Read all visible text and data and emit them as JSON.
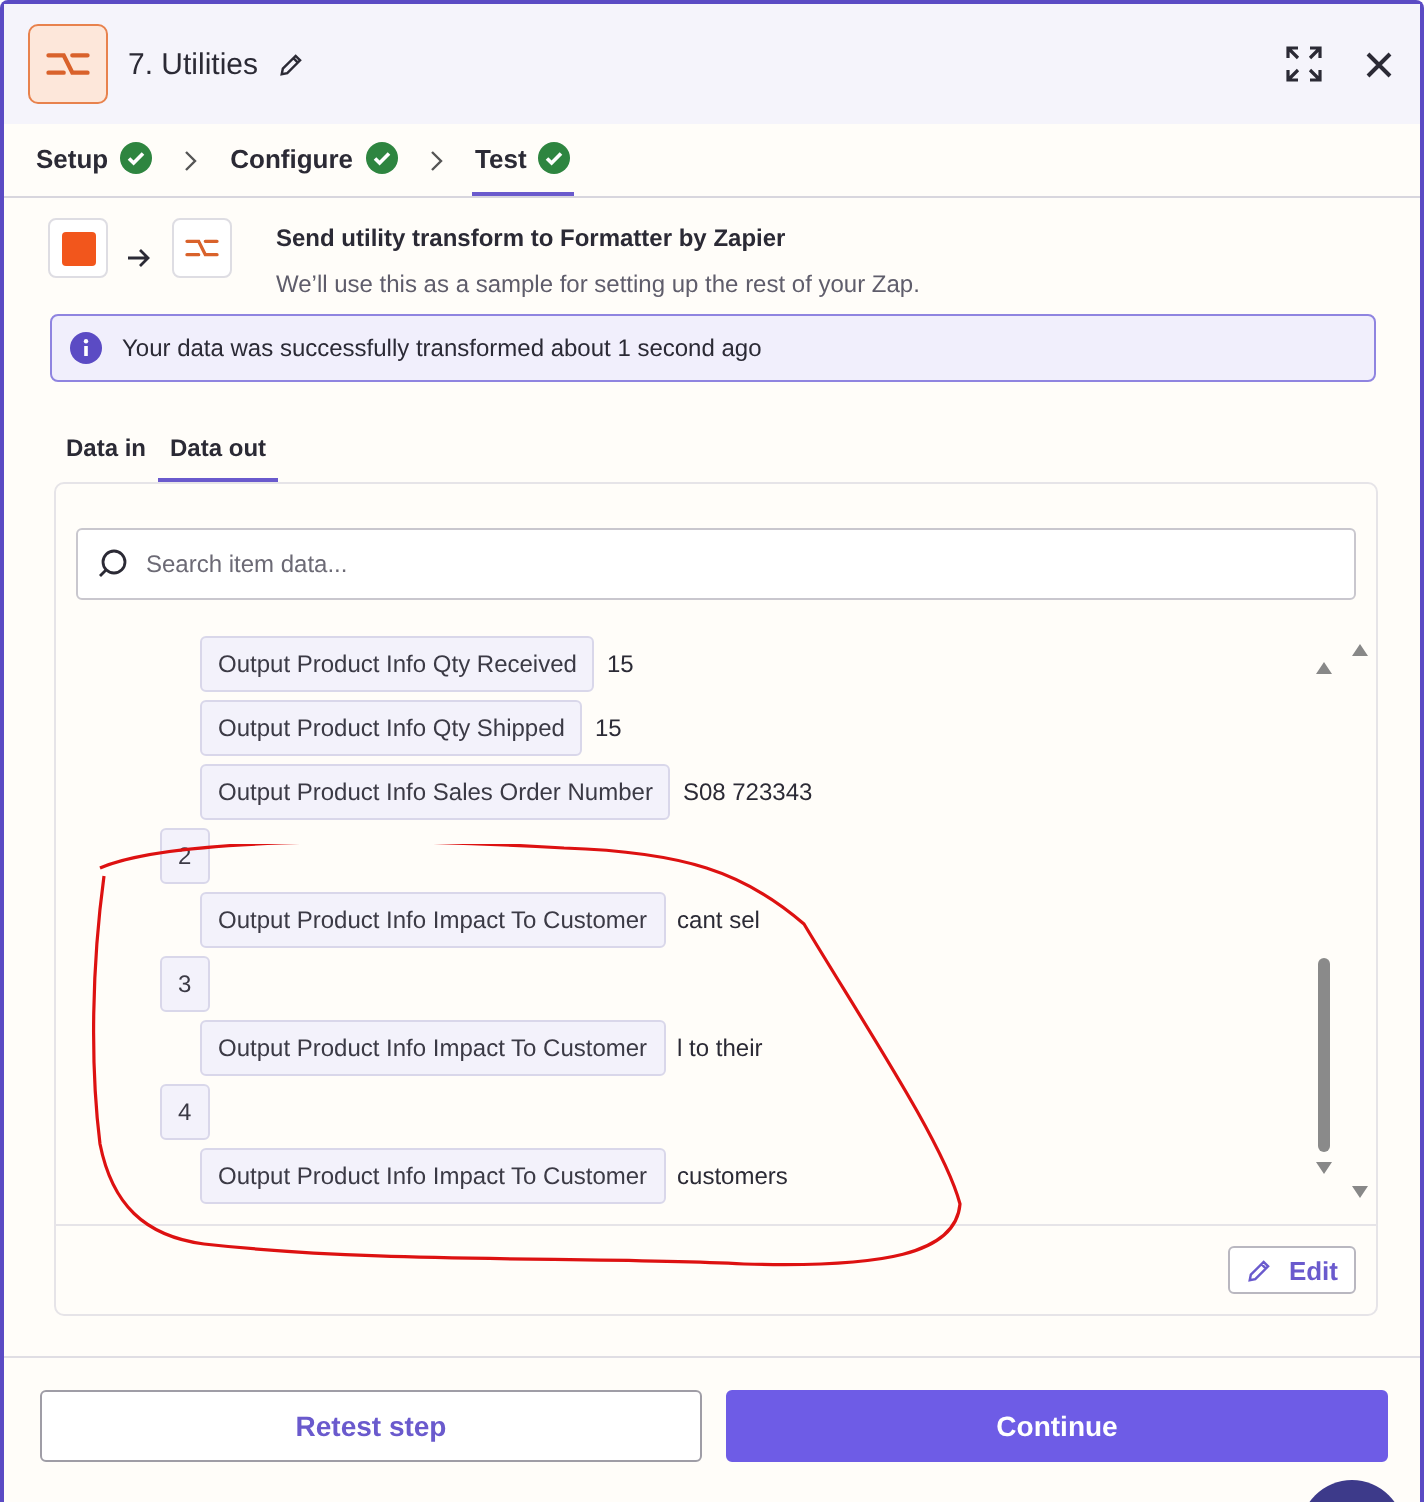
{
  "header": {
    "title": "7. Utilities"
  },
  "steps": [
    {
      "label": "Setup",
      "complete": true,
      "selected": false
    },
    {
      "label": "Configure",
      "complete": true,
      "selected": false
    },
    {
      "label": "Test",
      "complete": true,
      "selected": true
    }
  ],
  "step_summary": {
    "title": "Send utility transform to Formatter by Zapier",
    "subtitle": "We’ll use this as a sample for setting up the rest of your Zap."
  },
  "alert": {
    "text": "Your data was successfully transformed about 1 second ago"
  },
  "data_tabs": [
    {
      "label": "Data in",
      "selected": false
    },
    {
      "label": "Data out",
      "selected": true
    }
  ],
  "search": {
    "placeholder": "Search item data..."
  },
  "items": [
    {
      "kind": "field",
      "key": "Output Product Info Qty Received",
      "value": "15"
    },
    {
      "kind": "field",
      "key": "Output Product Info Qty Shipped",
      "value": "15"
    },
    {
      "kind": "field",
      "key": "Output Product Info Sales Order Number",
      "value": "S08 723343"
    },
    {
      "kind": "index",
      "key": "2"
    },
    {
      "kind": "field",
      "key": "Output Product Info Impact To Customer",
      "value": "cant sel"
    },
    {
      "kind": "index",
      "key": "3"
    },
    {
      "kind": "field",
      "key": "Output Product Info Impact To Customer",
      "value": "l to their"
    },
    {
      "kind": "index",
      "key": "4"
    },
    {
      "kind": "field",
      "key": "Output Product Info Impact To Customer",
      "value": "customers"
    }
  ],
  "edit_button": "Edit",
  "buttons": [
    {
      "label": "Retest step",
      "kind": "secondary"
    },
    {
      "label": "Continue",
      "kind": "primary"
    }
  ]
}
